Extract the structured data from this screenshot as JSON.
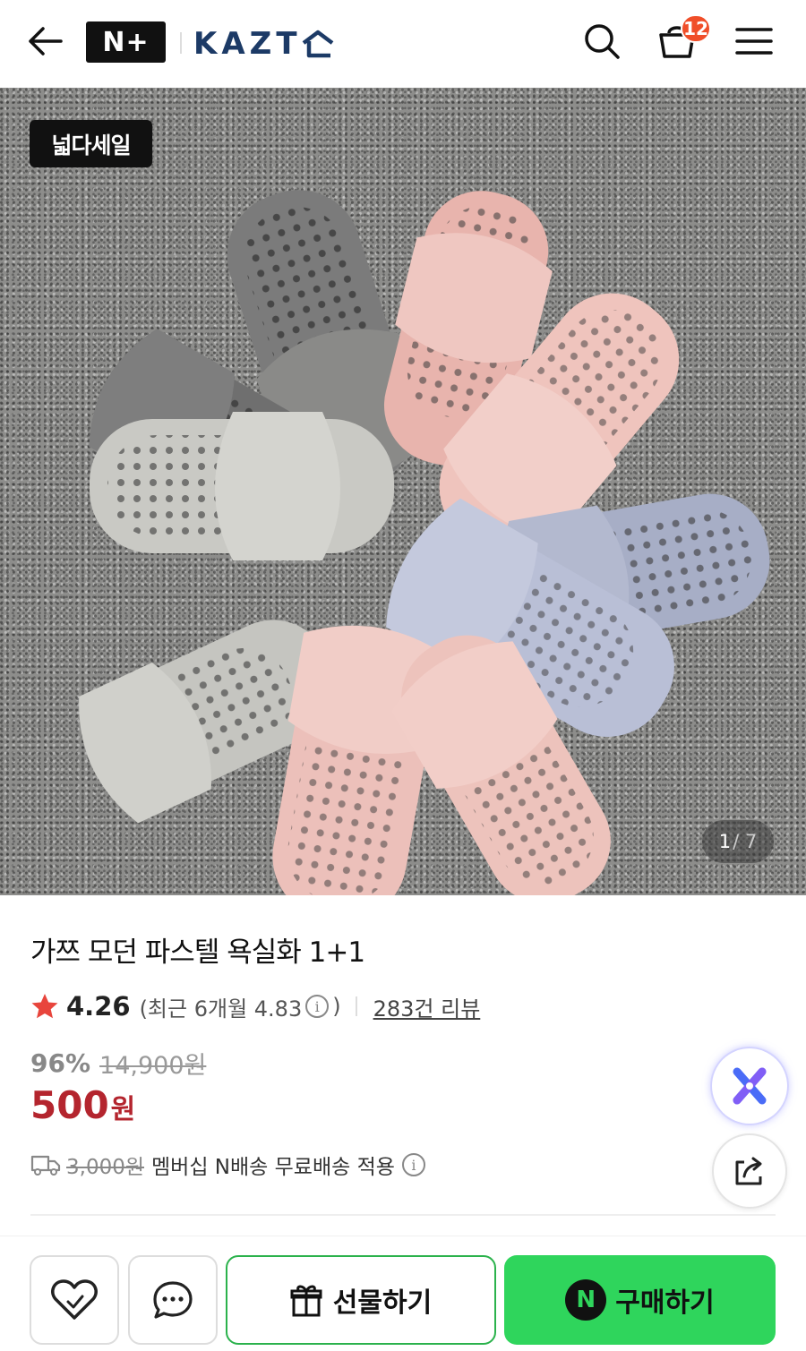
{
  "header": {
    "back_icon": "arrow-left-icon",
    "nplus_label": "N+",
    "brand": "KAZT",
    "search_icon": "search-icon",
    "cart_icon": "shopping-bag-icon",
    "cart_count": "12",
    "menu_icon": "hamburger-menu-icon",
    "badge_color": "#f04e29"
  },
  "hero": {
    "sale_tag": "넓다세일",
    "image_counter": {
      "current": "1",
      "total": "/ 7"
    }
  },
  "product": {
    "title": "가쯔 모던 파스텔 욕실화 1+1",
    "rating": "4.26",
    "recent_rating_prefix": "(최근 6개월 4.83",
    "recent_rating_suffix": ")",
    "reviews": "283건 리뷰",
    "discount": "96%",
    "original_price": "14,900원",
    "final_price": "500",
    "final_price_unit": "원",
    "price_color": "#b4252e"
  },
  "shipping": {
    "old_fee": "3,000원",
    "text": "멤버십 N배송 무료배송 적용"
  },
  "floating": {
    "ai_icon": "ai-assistant-icon",
    "share_icon": "share-icon"
  },
  "bottom_bar": {
    "like_icon": "heart-icon",
    "talk_icon": "chat-icon",
    "gift_label": "선물하기",
    "buy_badge": "N",
    "buy_label": "구매하기",
    "buy_color": "#2fd55c"
  }
}
